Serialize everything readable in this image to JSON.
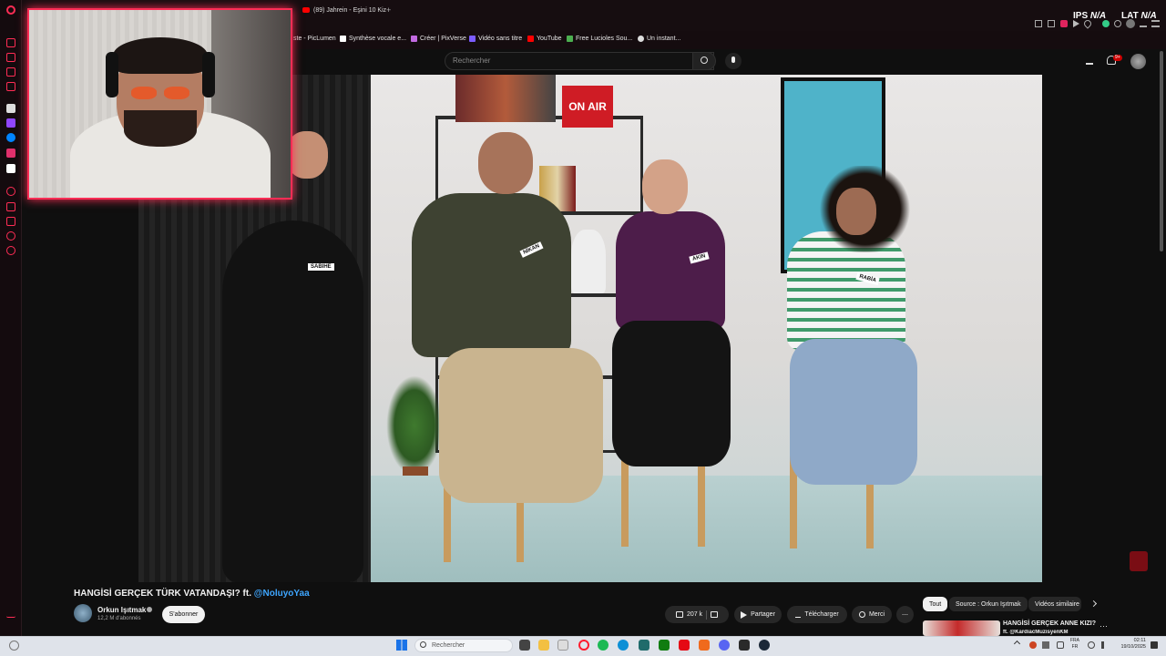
{
  "browser": {
    "active_tab_title": "(89) Jahrein - Eşini 10 Kiz",
    "new_tab_symbol": "+",
    "overlay_left_label": "IPS",
    "overlay_left_value": "N/A",
    "overlay_right_label": "LAT",
    "overlay_right_value": "N/A",
    "bookmarks": [
      "ste - PicLumen",
      "Synthèse vocale e...",
      "Créer | PixVerse",
      "Vidéo sans titre",
      "YouTube",
      "Free Lucioles Sou...",
      "Un instant..."
    ]
  },
  "youtube": {
    "search_placeholder": "Rechercher",
    "notification_badge": "9+",
    "video": {
      "on_air_sign": "ON AIR",
      "name_tags": [
        "SABIHE",
        "NİKAN",
        "AKIN",
        "RABİA"
      ]
    },
    "video_title": "HANGİSİ GERÇEK TÜRK VATANDAŞI? ft.",
    "video_title_mention": "@NoluyoYaa",
    "channel_name": "Orkun Işıtmak",
    "subscriber_count": "12,2 M d'abonnés",
    "subscribe_label": "S'abonner",
    "likes": "207 k",
    "share_label": "Partager",
    "download_label": "Télécharger",
    "thanks_label": "Merci",
    "more_label": "⋯",
    "chips": [
      "Tout",
      "Source : Orkun Işıtmak",
      "Vidéos similaire"
    ],
    "suggested_title": "HANGİSİ GERÇEK ANNE KIZI?",
    "suggested_subtitle": "ft. @KardiacMuzisyenKM"
  },
  "taskbar": {
    "search_placeholder": "Rechercher",
    "language": "FRA",
    "language_sub": "FR",
    "time": "02:11",
    "date": "19/10/2025"
  },
  "colors": {
    "accent": "#ff2d55",
    "link": "#3ea6ff"
  }
}
